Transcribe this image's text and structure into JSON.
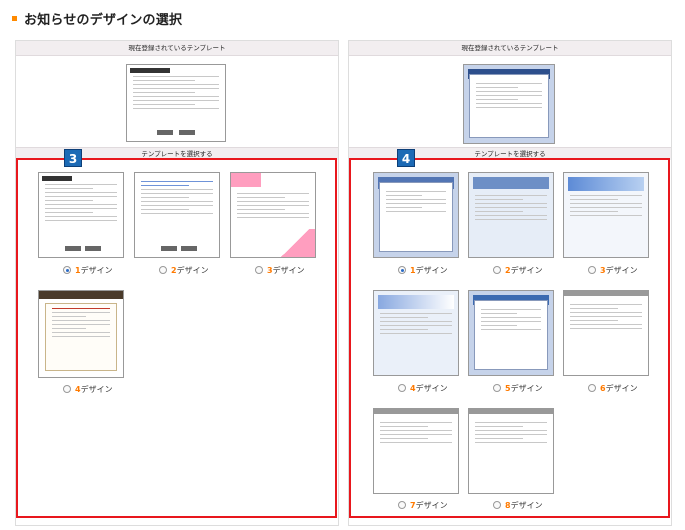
{
  "page": {
    "title": "お知らせのデザインの選択",
    "accent": "#ff8a00"
  },
  "left": {
    "current_header": "現在登録されているテンプレート",
    "select_header": "テンプレートを選択する",
    "badge": "3",
    "options": [
      {
        "num": "1",
        "suffix": "デザイン",
        "selected": true
      },
      {
        "num": "2",
        "suffix": "デザイン",
        "selected": false
      },
      {
        "num": "3",
        "suffix": "デザイン",
        "selected": false
      },
      {
        "num": "4",
        "suffix": "デザイン",
        "selected": false
      }
    ]
  },
  "right": {
    "current_header": "現在登録されているテンプレート",
    "select_header": "テンプレートを選択する",
    "badge": "4",
    "options": [
      {
        "num": "1",
        "suffix": "デザイン",
        "selected": true
      },
      {
        "num": "2",
        "suffix": "デザイン",
        "selected": false
      },
      {
        "num": "3",
        "suffix": "デザイン",
        "selected": false
      },
      {
        "num": "4",
        "suffix": "デザイン",
        "selected": false
      },
      {
        "num": "5",
        "suffix": "デザイン",
        "selected": false
      },
      {
        "num": "6",
        "suffix": "デザイン",
        "selected": false
      },
      {
        "num": "7",
        "suffix": "デザイン",
        "selected": false
      },
      {
        "num": "8",
        "suffix": "デザイン",
        "selected": false
      }
    ]
  },
  "colors": {
    "red_border": "#e8171d",
    "badge_blue": "#1c6ab5",
    "selected_radio": "#2a6bc6"
  }
}
